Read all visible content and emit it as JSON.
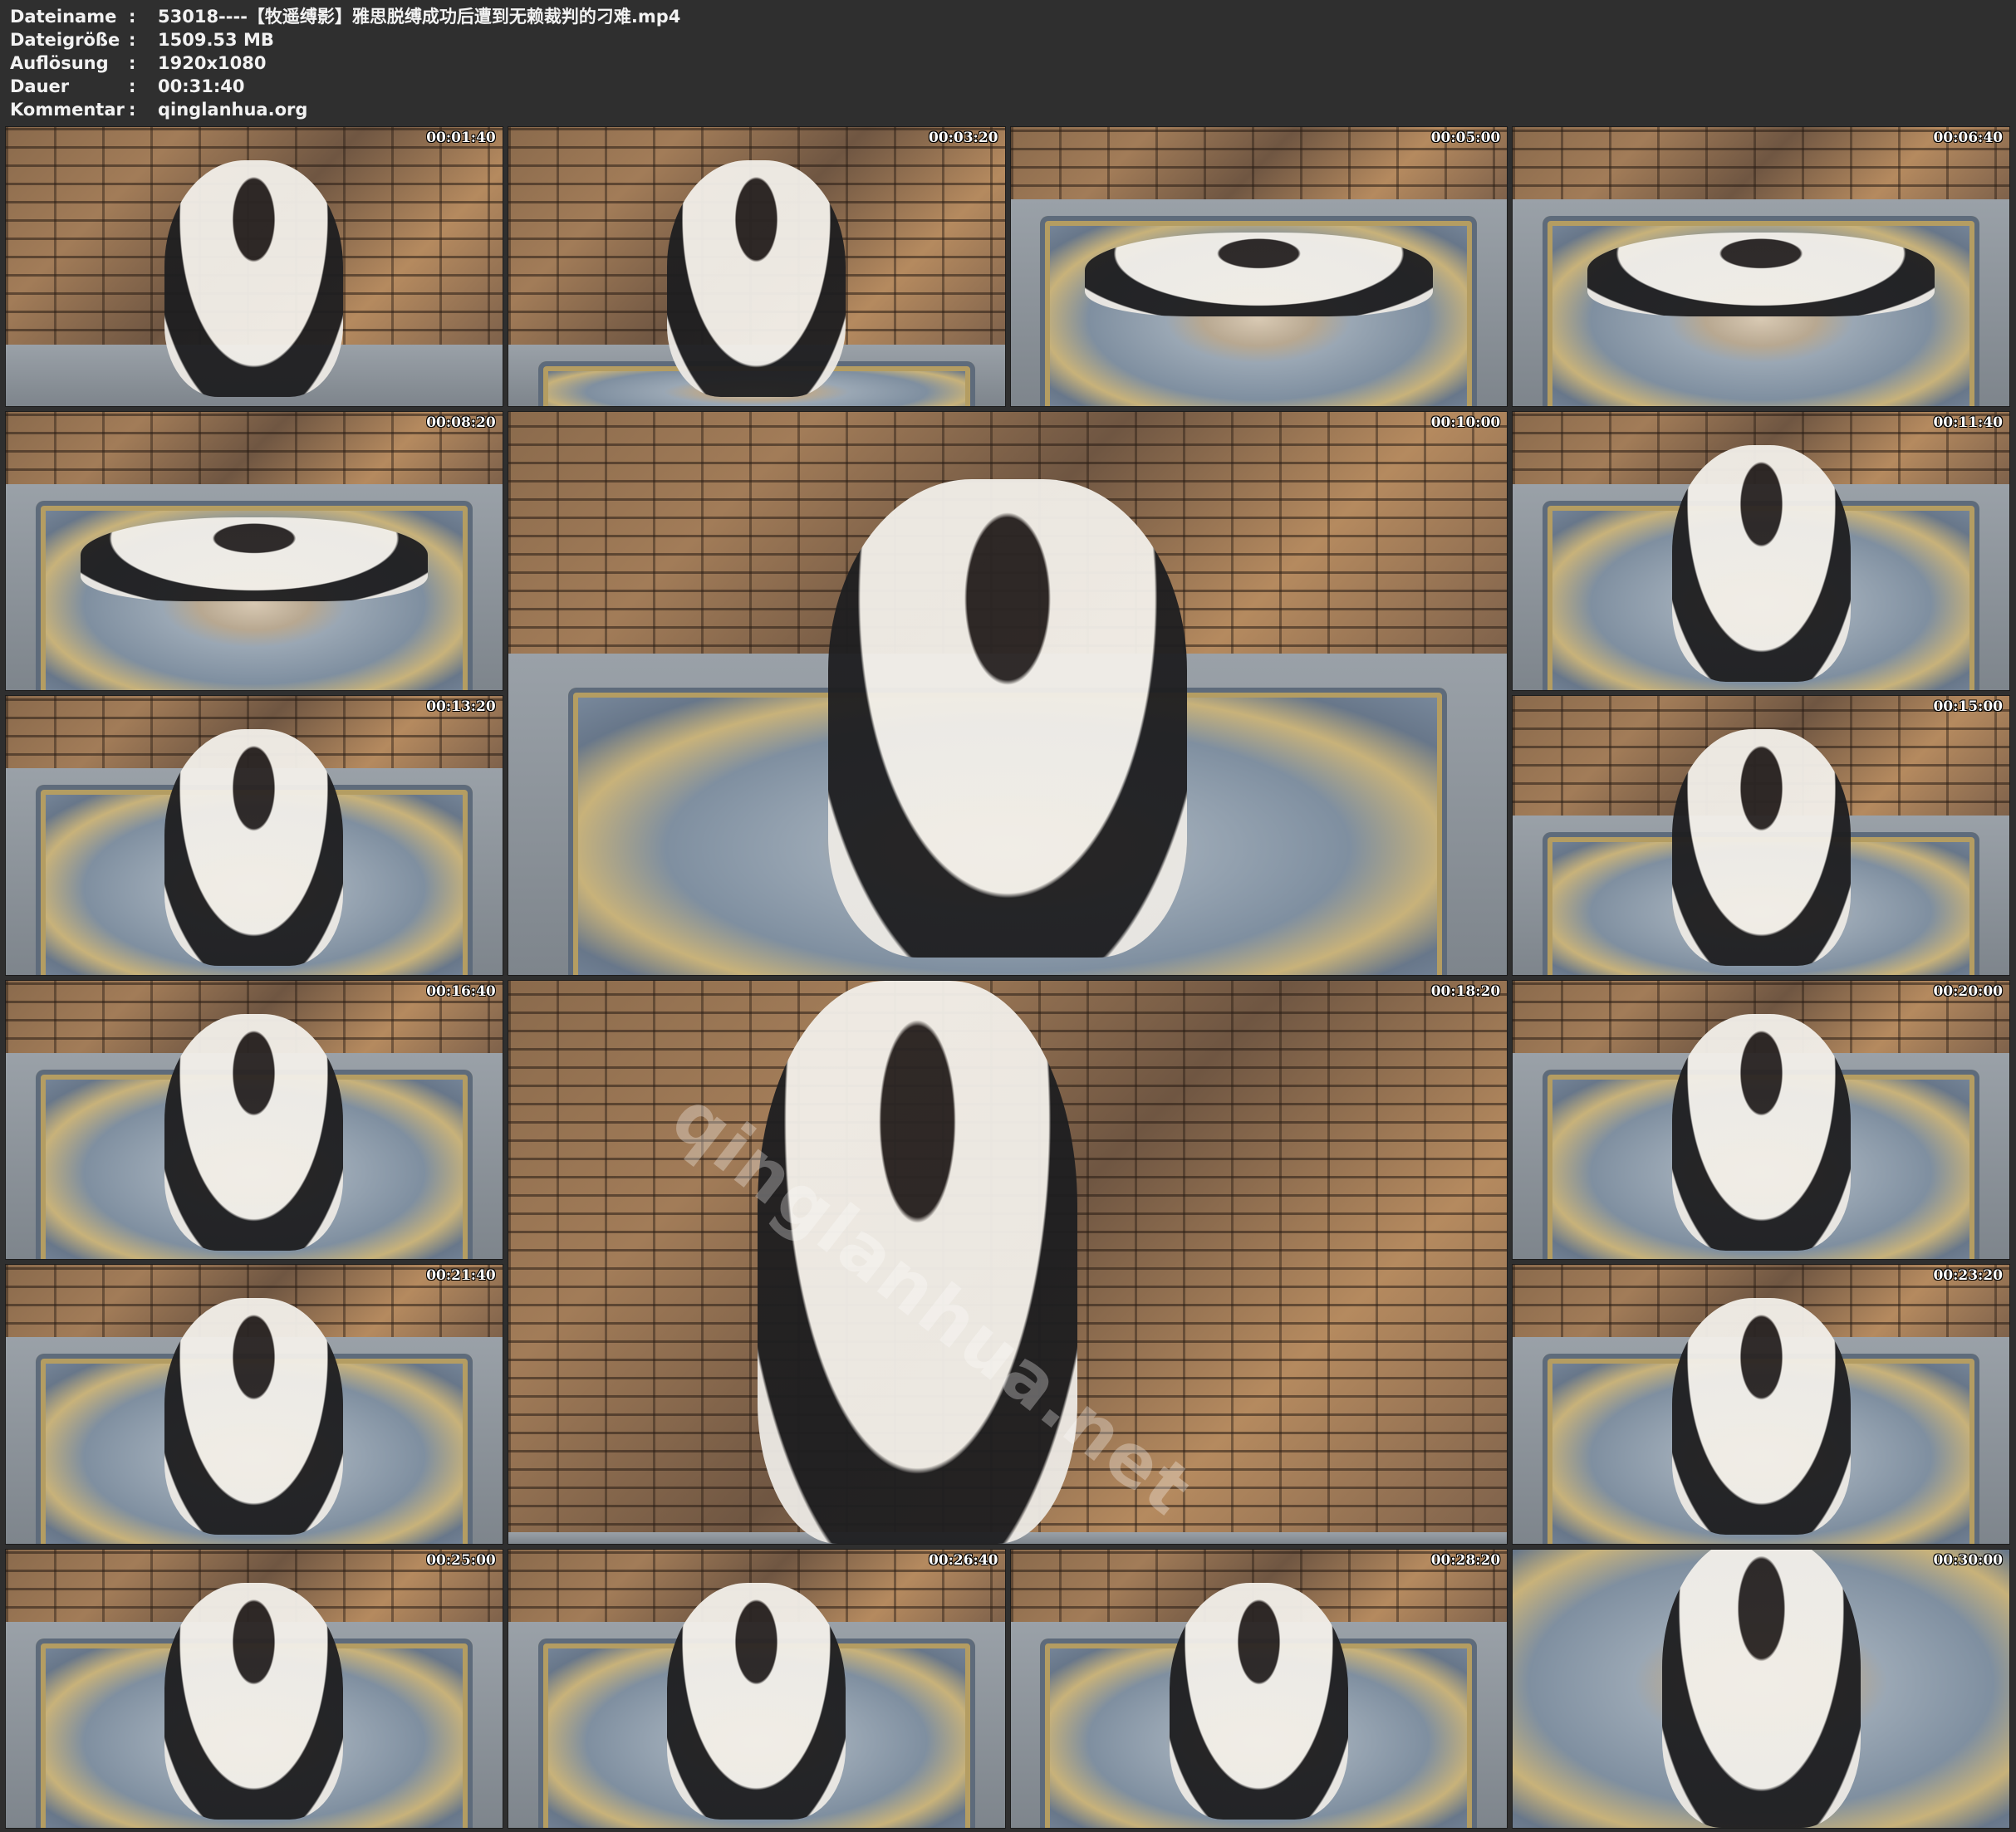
{
  "metadata": [
    {
      "key": "Dateiname",
      "value": "53018----【牧遥缚影】雅思脱缚成功后遭到无赖裁判的刁难.mp4"
    },
    {
      "key": "Dateigröße",
      "value": "1509.53 MB"
    },
    {
      "key": "Auflösung",
      "value": "1920x1080"
    },
    {
      "key": "Dauer",
      "value": "00:31:40"
    },
    {
      "key": "Kommentar",
      "value": "qinglanhua.org"
    }
  ],
  "colon": ":",
  "thumbnails": [
    {
      "time": "00:01:40",
      "scene": "wall-standing"
    },
    {
      "time": "00:03:20",
      "scene": "wall-seated"
    },
    {
      "time": "00:05:00",
      "scene": "rug-lying"
    },
    {
      "time": "00:06:40",
      "scene": "rug-lying"
    },
    {
      "time": "00:08:20",
      "scene": "rug-lying"
    },
    {
      "time": "00:10:00",
      "scene": "corner-kneeling"
    },
    {
      "time": "00:11:40",
      "scene": "rug-sitting"
    },
    {
      "time": "00:13:20",
      "scene": "rug-sitting"
    },
    {
      "time": "00:15:00",
      "scene": "corner-back"
    },
    {
      "time": "00:16:40",
      "scene": "rug-sitting"
    },
    {
      "time": "00:18:20",
      "scene": "closeup"
    },
    {
      "time": "00:20:00",
      "scene": "rug-sitting"
    },
    {
      "time": "00:21:40",
      "scene": "rug-sitting"
    },
    {
      "time": "00:23:20",
      "scene": "rug-sitting"
    },
    {
      "time": "00:25:00",
      "scene": "rug-sitting"
    },
    {
      "time": "00:26:40",
      "scene": "rug-sitting"
    },
    {
      "time": "00:28:20",
      "scene": "rug-sitting"
    },
    {
      "time": "00:30:00",
      "scene": "rug-closeup"
    }
  ],
  "watermark": "qinglanhua.net"
}
